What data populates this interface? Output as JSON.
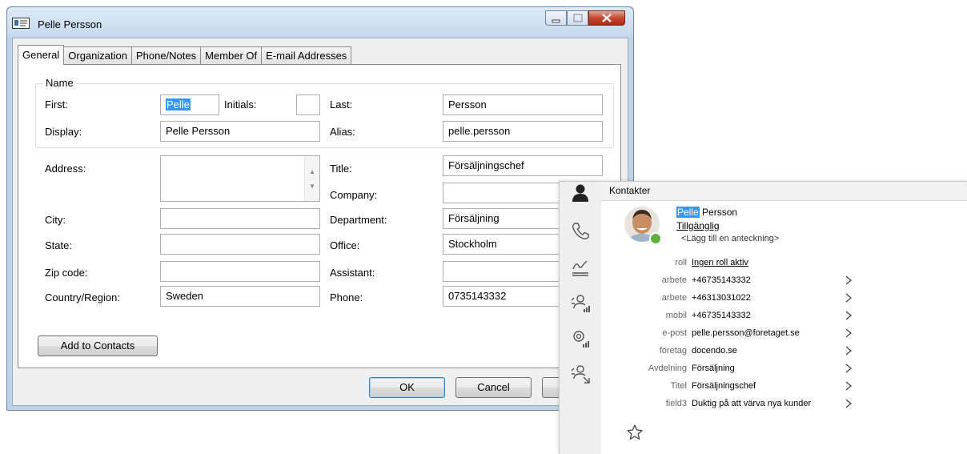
{
  "dialog": {
    "title": "Pelle Persson",
    "icons": {
      "window": "contact-card-icon",
      "minimize": "minimize-icon",
      "maximize": "maximize-icon",
      "close": "close-icon"
    },
    "tabs": [
      "General",
      "Organization",
      "Phone/Notes",
      "Member Of",
      "E-mail Addresses"
    ],
    "active_tab": "General",
    "name_group": "Name",
    "labels": {
      "first": "First:",
      "initials": "Initials:",
      "last": "Last:",
      "display": "Display:",
      "alias": "Alias:",
      "address": "Address:",
      "title": "Title:",
      "company": "Company:",
      "city": "City:",
      "department": "Department:",
      "state": "State:",
      "office": "Office:",
      "zip": "Zip code:",
      "assistant": "Assistant:",
      "country": "Country/Region:",
      "phone": "Phone:"
    },
    "values": {
      "first": "Pelle",
      "initials": "",
      "last": "Persson",
      "display": "Pelle Persson",
      "alias": "pelle.persson",
      "address": "",
      "title": "Försäljningschef",
      "company": "",
      "city": "",
      "department": "Försäljning",
      "state": "",
      "office": "Stockholm",
      "zip": "",
      "assistant": "",
      "country": "Sweden",
      "phone": "0735143332"
    },
    "buttons": {
      "add_to_contacts": "Add to Contacts",
      "ok": "OK",
      "cancel": "Cancel"
    }
  },
  "contact_card": {
    "header": "Kontakter",
    "rail_icons": [
      "person-icon",
      "phone-icon",
      "signature-icon",
      "group-call-icon",
      "audio-call-icon",
      "transfer-icon"
    ],
    "first_name": "Pelle",
    "last_name": "Persson",
    "status": "Tillgänglig",
    "presence_color": "#5db13f",
    "note_placeholder": "<Lägg till en anteckning>",
    "fields": [
      {
        "key": "roll",
        "value": "Ingen roll aktiv",
        "link": true,
        "chevron": false
      },
      {
        "key": "arbete",
        "value": "+46735143332",
        "link": false,
        "chevron": true
      },
      {
        "key": "arbete",
        "value": "+46313031022",
        "link": false,
        "chevron": true
      },
      {
        "key": "mobil",
        "value": "+46735143332",
        "link": false,
        "chevron": true
      },
      {
        "key": "e-post",
        "value": "pelle.persson@foretaget.se",
        "link": false,
        "chevron": true
      },
      {
        "key": "företag",
        "value": "docendo.se",
        "link": false,
        "chevron": true
      },
      {
        "key": "Avdelning",
        "value": "Försäljning",
        "link": false,
        "chevron": true
      },
      {
        "key": "Titel",
        "value": "Försäljningschef",
        "link": false,
        "chevron": true
      },
      {
        "key": "field3",
        "value": "Duktig på att värva nya kunder",
        "link": false,
        "chevron": true
      }
    ]
  }
}
